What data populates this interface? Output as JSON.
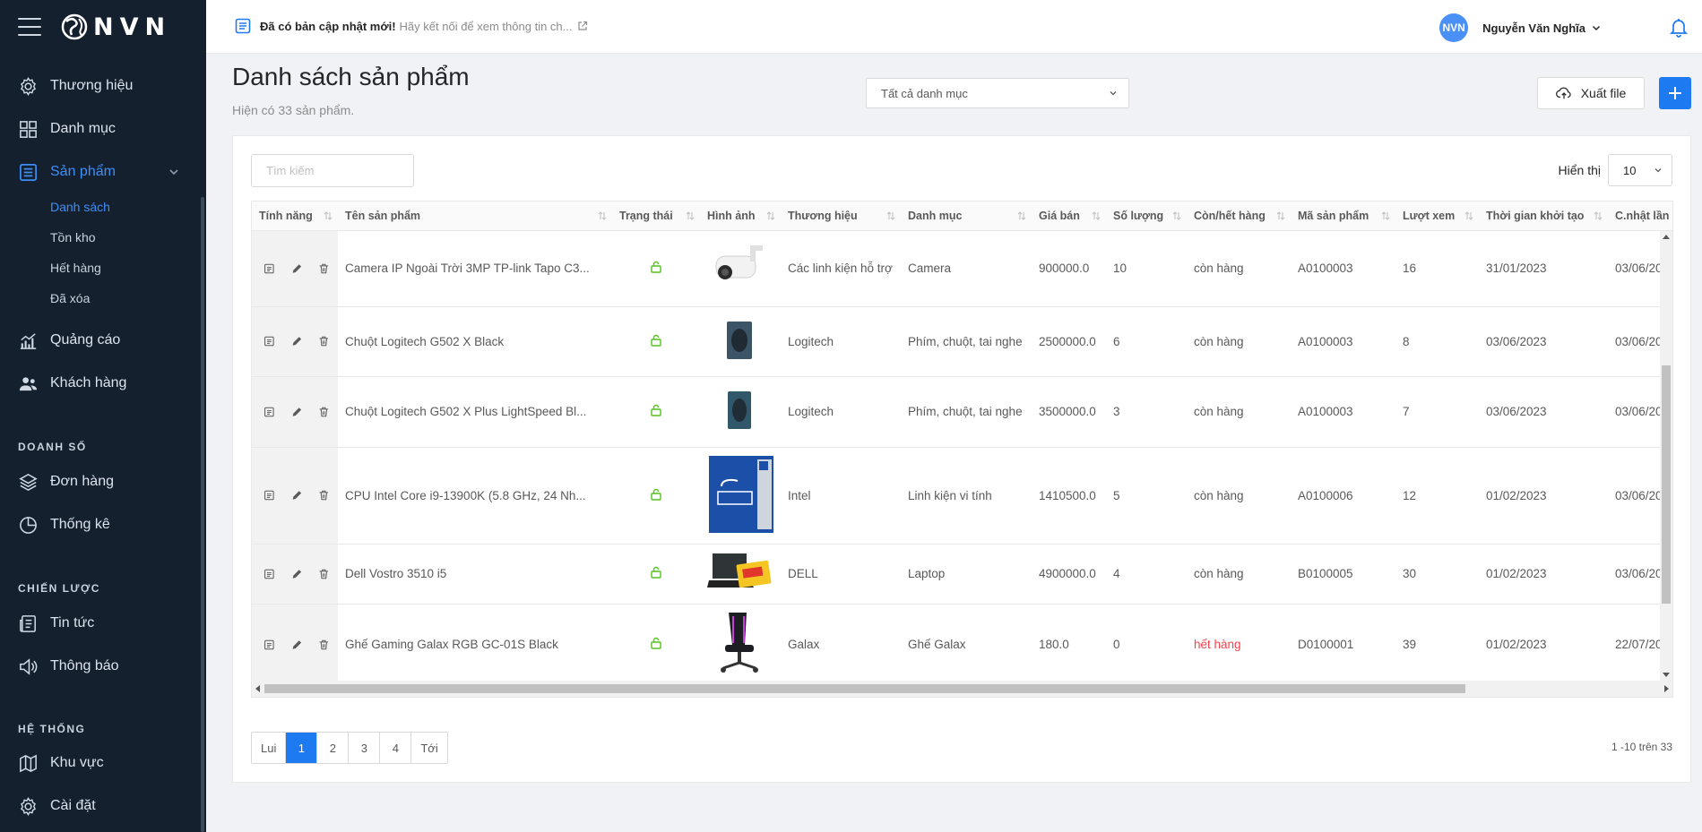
{
  "sidebar": {
    "logo_text": "NVN",
    "items": [
      {
        "label": "Thương hiệu"
      },
      {
        "label": "Danh mục"
      },
      {
        "label": "Sản phẩm"
      },
      {
        "label": "Quảng cáo"
      },
      {
        "label": "Khách hàng"
      },
      {
        "label": "Đơn hàng"
      },
      {
        "label": "Thống kê"
      },
      {
        "label": "Tin tức"
      },
      {
        "label": "Thông báo"
      },
      {
        "label": "Khu vực"
      },
      {
        "label": "Cài đặt"
      }
    ],
    "sub_items": [
      "Danh sách",
      "Tồn kho",
      "Hết hàng",
      "Đã xóa"
    ],
    "sections": [
      "DOANH SỐ",
      "CHIẾN LƯỢC",
      "HỆ THỐNG"
    ]
  },
  "header": {
    "notice_strong": "Đã có bản cập nhật mới!",
    "notice_link": "Hãy kết nối để xem thông tin ch...",
    "avatar": "NVN",
    "user_name": "Nguyễn Văn Nghĩa"
  },
  "page": {
    "title": "Danh sách sản phẩm",
    "subtitle": "Hiện có 33 sản phẩm.",
    "category_filter": "Tất cả danh mục",
    "export_label": "Xuất file",
    "search_placeholder": "Tìm kiếm",
    "show_label": "Hiển thị",
    "show_value": "10"
  },
  "table": {
    "columns": [
      "Tính năng",
      "Tên sản phẩm",
      "Trạng thái",
      "Hình ảnh",
      "Thương hiệu",
      "Danh mục",
      "Giá bán",
      "Số lượng",
      "Còn/hết hàng",
      "Mã sản phẩm",
      "Lượt xem",
      "Thời gian khởi tạo",
      "C.nhật lần"
    ],
    "rows": [
      {
        "name": "Camera IP Ngoài Trời 3MP TP-link Tapo C3...",
        "brand": "Các linh kiện hỗ trợ",
        "category": "Camera",
        "price": "900000.0",
        "qty": "10",
        "stock": "còn hàng",
        "code": "A0100003",
        "views": "16",
        "created": "31/01/2023",
        "updated": "03/06/20"
      },
      {
        "name": "Chuột Logitech G502 X Black",
        "brand": "Logitech",
        "category": "Phím, chuột, tai nghe",
        "price": "2500000.0",
        "qty": "6",
        "stock": "còn hàng",
        "code": "A0100003",
        "views": "8",
        "created": "03/06/2023",
        "updated": "03/06/20"
      },
      {
        "name": "Chuột Logitech G502 X Plus LightSpeed Bl...",
        "brand": "Logitech",
        "category": "Phím, chuột, tai nghe",
        "price": "3500000.0",
        "qty": "3",
        "stock": "còn hàng",
        "code": "A0100003",
        "views": "7",
        "created": "03/06/2023",
        "updated": "03/06/20"
      },
      {
        "name": "CPU Intel Core i9-13900K (5.8 GHz, 24 Nh...",
        "brand": "Intel",
        "category": "Linh kiện vi tính",
        "price": "1410500.0",
        "qty": "5",
        "stock": "còn hàng",
        "code": "A0100006",
        "views": "12",
        "created": "01/02/2023",
        "updated": "03/06/20"
      },
      {
        "name": "Dell Vostro 3510 i5",
        "brand": "DELL",
        "category": "Laptop",
        "price": "4900000.0",
        "qty": "4",
        "stock": "còn hàng",
        "code": "B0100005",
        "views": "30",
        "created": "01/02/2023",
        "updated": "03/06/20"
      },
      {
        "name": "Ghế Gaming Galax RGB GC-01S Black",
        "brand": "Galax",
        "category": "Ghế Galax",
        "price": "180.0",
        "qty": "0",
        "stock": "hết hàng",
        "code": "D0100001",
        "views": "39",
        "created": "01/02/2023",
        "updated": "22/07/20"
      }
    ]
  },
  "pagination": {
    "prev": "Lui",
    "pages": [
      "1",
      "2",
      "3",
      "4"
    ],
    "next": "Tới",
    "info": "1 -10 trên 33"
  },
  "colors": {
    "sidebar_bg": "#15202e",
    "accent": "#1e7af0",
    "active_nav": "#3d8ef7",
    "status_green": "#52c41a",
    "out_of_stock": "#f5414b"
  }
}
